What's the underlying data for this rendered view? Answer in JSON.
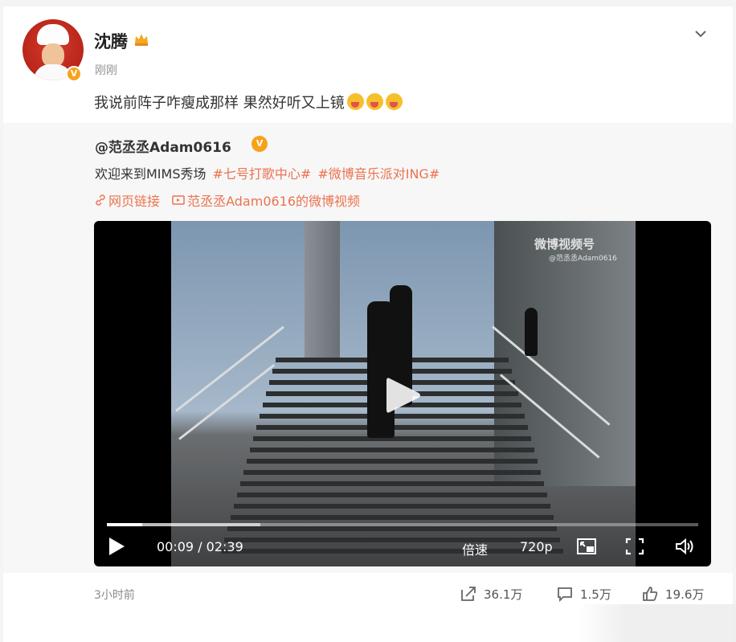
{
  "author": {
    "name": "沈腾",
    "time": "刚刚"
  },
  "post": {
    "text": "我说前阵子咋瘦成那样 果然好听又上镜"
  },
  "repost": {
    "author": "@范丞丞Adam0616",
    "text": "欢迎来到MIMS秀场",
    "topics": [
      "#七号打歌中心#",
      "#微博音乐派对ING#"
    ],
    "links": [
      "网页链接",
      "范丞丞Adam0616的微博视频"
    ]
  },
  "video": {
    "watermark": "微博视频号",
    "watermark_sub": "@范丞丞Adam0616",
    "current_time": "00:09",
    "duration": "02:39",
    "speed_label": "倍速",
    "quality_label": "720p",
    "progress": 0.06,
    "buffered": 0.26
  },
  "footer": {
    "time": "3小时前",
    "shares": "36.1万",
    "comments": "1.5万",
    "likes": "19.6万"
  },
  "colors": {
    "accent": "#eb7350",
    "verified": "#f7a21b"
  }
}
